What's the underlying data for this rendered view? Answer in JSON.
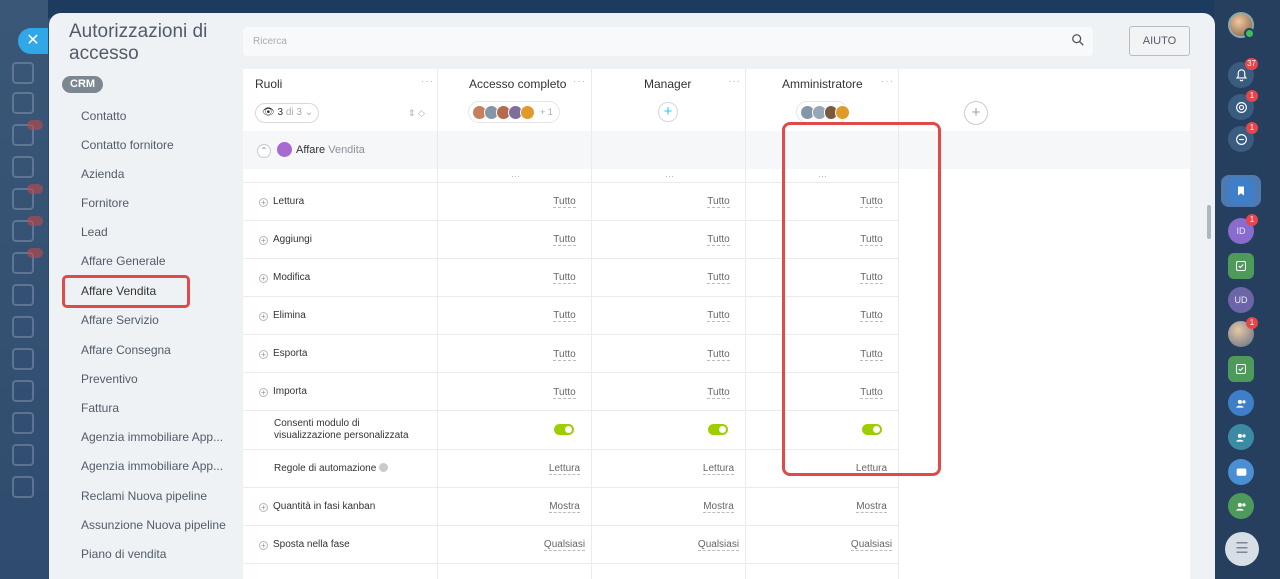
{
  "panel": {
    "title": "Autorizzazioni di accesso",
    "crm_badge": "CRM",
    "search_placeholder": "Ricerca",
    "help_label": "AIUTO"
  },
  "sidebar": {
    "items": [
      {
        "label": "Contatto"
      },
      {
        "label": "Contatto fornitore"
      },
      {
        "label": "Azienda"
      },
      {
        "label": "Fornitore"
      },
      {
        "label": "Lead"
      },
      {
        "label": "Affare Generale"
      },
      {
        "label": "Affare Vendita",
        "highlighted": true
      },
      {
        "label": "Affare Servizio"
      },
      {
        "label": "Affare Consegna"
      },
      {
        "label": "Preventivo"
      },
      {
        "label": "Fattura"
      },
      {
        "label": "Agenzia immobiliare App..."
      },
      {
        "label": "Agenzia immobiliare App..."
      },
      {
        "label": "Reclami Nuova pipeline"
      },
      {
        "label": "Assunzione Nuova pipeline"
      },
      {
        "label": "Piano di vendita"
      }
    ]
  },
  "table": {
    "roles_header": "Ruoli",
    "roles_filter": {
      "shown": "3",
      "of_text": "di 3"
    },
    "columns": [
      {
        "title": "Accesso completo",
        "avatars_more": "+ 1"
      },
      {
        "title": "Manager"
      },
      {
        "title": "Amministratore"
      }
    ],
    "section": {
      "name": "Affare",
      "entity": "Vendita"
    },
    "rows": [
      {
        "label": "Lettura",
        "expandable": true,
        "values": [
          "Tutto",
          "Tutto",
          "Tutto"
        ]
      },
      {
        "label": "Aggiungi",
        "expandable": true,
        "values": [
          "Tutto",
          "Tutto",
          "Tutto"
        ]
      },
      {
        "label": "Modifica",
        "expandable": true,
        "values": [
          "Tutto",
          "Tutto",
          "Tutto"
        ]
      },
      {
        "label": "Elimina",
        "expandable": true,
        "values": [
          "Tutto",
          "Tutto",
          "Tutto"
        ]
      },
      {
        "label": "Esporta",
        "expandable": true,
        "values": [
          "Tutto",
          "Tutto",
          "Tutto"
        ]
      },
      {
        "label": "Importa",
        "expandable": true,
        "values": [
          "Tutto",
          "Tutto",
          "Tutto"
        ]
      },
      {
        "label": "Consenti modulo di visualizzazione personalizzata",
        "expandable": false,
        "toggle": [
          true,
          true,
          true
        ]
      },
      {
        "label": "Regole di automazione",
        "expandable": false,
        "info": true,
        "values": [
          "Lettura",
          "Lettura",
          "Lettura"
        ]
      },
      {
        "label": "Quantità in fasi kanban",
        "expandable": true,
        "values": [
          "Mostra",
          "Mostra",
          "Mostra"
        ]
      },
      {
        "label": "Sposta nella fase",
        "expandable": true,
        "values": [
          "Qualsiasi",
          "Qualsiasi",
          "Qualsiasi"
        ]
      }
    ]
  },
  "rail": {
    "badges": {
      "notifications": "37",
      "pulse": "1",
      "chat": "1",
      "idea": "1",
      "avatar2": "1"
    },
    "labels": {
      "id": "ID",
      "ud": "UD"
    }
  },
  "colors": {
    "accent": "#2fc6f6",
    "highlight": "#e04a4a",
    "toggle_on": "#9dcf00",
    "close": "#2fa7e8"
  }
}
